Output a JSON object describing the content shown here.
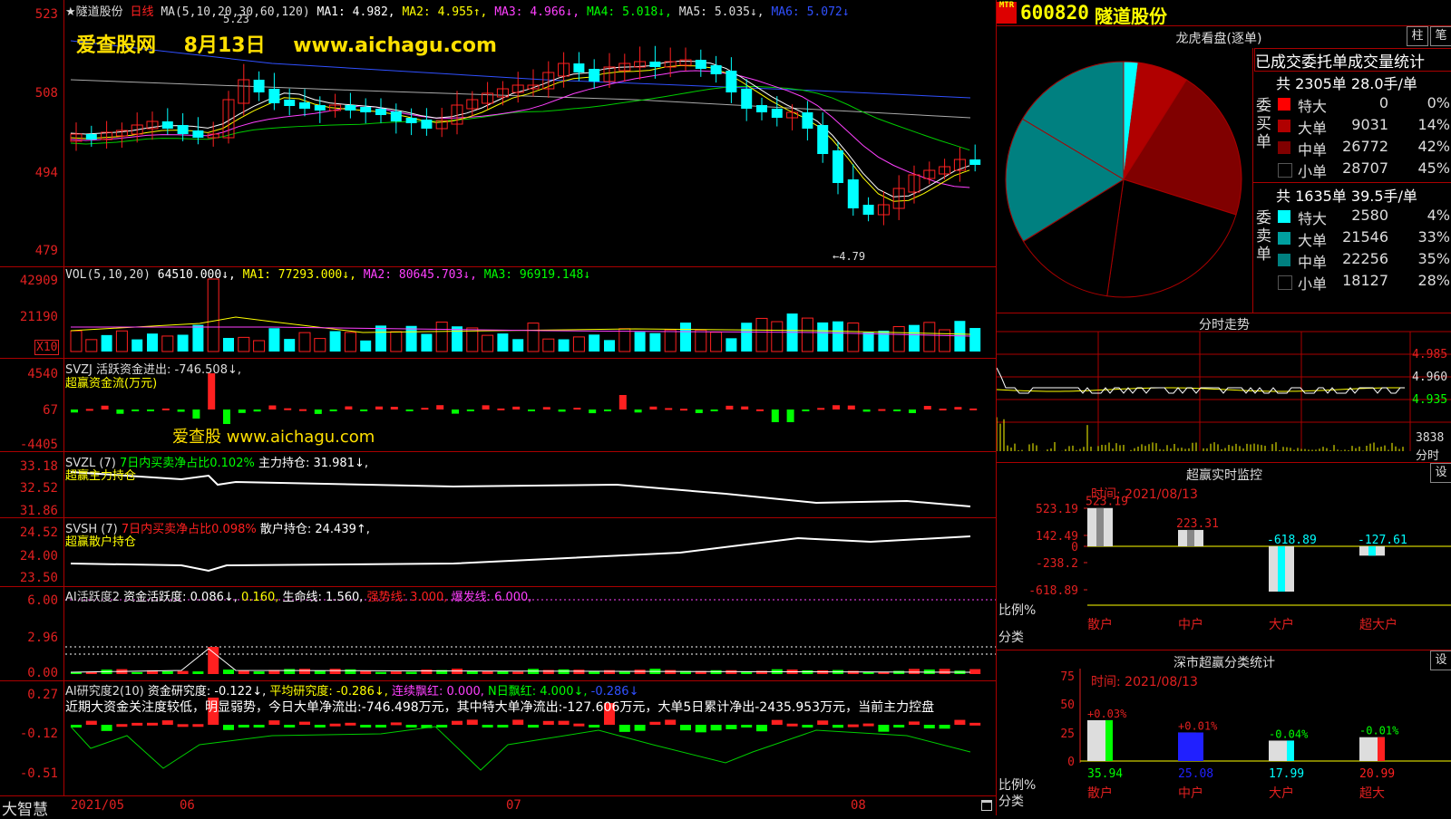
{
  "colors": {
    "up": "#ff2020",
    "down": "#00ffff",
    "bg": "#000000",
    "grid": "#aa0000",
    "yellow": "#ffff00",
    "magenta": "#ff40ff",
    "green": "#00ff00",
    "white": "#ffffff",
    "axis": "#e02020"
  },
  "watermark": {
    "site": "爱查股网",
    "date": "8月13日",
    "url": "www.aichagu.com",
    "small": "爱查股 www.aichagu.com"
  },
  "kline": {
    "title": "★隧道股份",
    "period": "日线",
    "ma_params": "MA(5,10,20,30,60,120)",
    "ma1": "MA1: 4.982,",
    "ma2": "MA2: 4.955↑,",
    "ma3": "MA3: 4.966↓,",
    "ma4": "MA4: 5.018↓,",
    "ma5": "MA5: 5.035↓,",
    "ma6": "MA6: 5.072↓",
    "y_labels": [
      "523",
      "508",
      "494",
      "479"
    ],
    "high_label": "5.23",
    "low_label": "←4.79"
  },
  "vol": {
    "header": "VOL(5,10,20)",
    "v": "64510.000↓,",
    "ma1": "MA1: 77293.000↓,",
    "ma2": "MA2: 80645.703↓,",
    "ma3": "MA3: 96919.148↓",
    "y_labels": [
      "42909",
      "21190"
    ],
    "unit": "X10"
  },
  "svzj": {
    "header": "SVZJ  活跃资金进出: -746.508↓,",
    "sub": "超赢资金流(万元)",
    "y_labels": [
      "4540",
      "67",
      "-4405"
    ]
  },
  "svzl": {
    "header": "SVZL (7)",
    "tag": "7日内买卖净占比0.102%",
    "val": "主力持仓: 31.981↓,",
    "sub": "超赢主力持仓",
    "y_labels": [
      "33.18",
      "32.52",
      "31.86"
    ]
  },
  "svsh": {
    "header": "SVSH (7)",
    "tag": "7日内买卖净占比0.098%",
    "val": "散户持仓: 24.439↑,",
    "sub": "超赢散户持仓",
    "y_labels": [
      "24.52",
      "24.00",
      "23.50"
    ]
  },
  "aihy": {
    "header": "AI活跃度2",
    "a": "资金活跃度: 0.086↓,",
    "b": "0.160,",
    "c": "生命线: 1.560,",
    "d": "强势线: 3.000,",
    "e": "爆发线: 6.000,",
    "y_labels": [
      "6.00",
      "2.96",
      "0.00"
    ]
  },
  "aiyj": {
    "header": "AI研究度2(10)",
    "a": "资金研究度: -0.122↓,",
    "b": "平均研究度: -0.286↓,",
    "c": "连续飘红: 0.000,",
    "d": "N日飘红: 4.000↓,",
    "e": "-0.286↓",
    "note": "近期大资金关注度较低，明显弱势，今日大单净流出:-746.498万元，其中特大单净流出:-127.606万元，大单5日累计净出-2435.953万元，当前主力控盘",
    "y_labels": [
      "0.27",
      "-0.12",
      "-0.51"
    ]
  },
  "bottom": {
    "brand": "大智慧",
    "dates": [
      "2021/05",
      "06",
      "07",
      "08"
    ]
  },
  "right": {
    "code": "600820",
    "name": "隧道股份",
    "logo": "MTR",
    "lhb_title": "龙虎看盘(逐单)",
    "btn_zhu": "柱",
    "btn_bi": "笔",
    "stats_title": "已成交委托单成交量统计",
    "buy": {
      "label": "委买单",
      "summary": "共 2305单 28.0手/单",
      "rows": [
        {
          "name": "特大",
          "val": "0",
          "pct": "0%",
          "color": "#ff0000"
        },
        {
          "name": "大单",
          "val": "9031",
          "pct": "14%",
          "color": "#b00000"
        },
        {
          "name": "中单",
          "val": "26772",
          "pct": "42%",
          "color": "#800000"
        },
        {
          "name": "小单",
          "val": "28707",
          "pct": "45%",
          "color": "#000000"
        }
      ]
    },
    "sell": {
      "label": "委卖单",
      "summary": "共 1635单 39.5手/单",
      "rows": [
        {
          "name": "特大",
          "val": "2580",
          "pct": "4%",
          "color": "#00ffff"
        },
        {
          "name": "大单",
          "val": "21546",
          "pct": "33%",
          "color": "#00a0a0"
        },
        {
          "name": "中单",
          "val": "22256",
          "pct": "35%",
          "color": "#008080"
        },
        {
          "name": "小单",
          "val": "18127",
          "pct": "28%",
          "color": "#000000"
        }
      ]
    },
    "pie": [
      {
        "label": "特大卖",
        "share": 4,
        "color": "#00ffff"
      },
      {
        "label": "特大买",
        "share": 0,
        "color": "#ff0000"
      },
      {
        "label": "大买",
        "share": 14,
        "color": "#b00000"
      },
      {
        "label": "中买",
        "share": 42,
        "color": "#800000"
      },
      {
        "label": "小买",
        "share": 45,
        "color": "#000000"
      },
      {
        "label": "小卖",
        "share": 28,
        "color": "#000000"
      },
      {
        "label": "中卖",
        "share": 35,
        "color": "#008080"
      },
      {
        "label": "大卖",
        "share": 33,
        "color": "#008080"
      }
    ],
    "fs_title": "分时走势",
    "fs_y": [
      "4.985",
      "4.960",
      "4.935"
    ],
    "fs_vol": "3838",
    "fs_unit": "分时",
    "mon_title": "超赢实时监控",
    "mon_set": "设",
    "mon_time": "时间: 2021/08/13",
    "mon_y": [
      "523.19",
      "142.49",
      "0",
      "-238.2",
      "-618.89"
    ],
    "mon_ratio": "比例%",
    "mon_cat_label": "分类",
    "mon_bars": [
      {
        "cat": "散户",
        "val": 523.19,
        "label": "523.19"
      },
      {
        "cat": "中户",
        "val": 223.31,
        "label": "223.31"
      },
      {
        "cat": "大户",
        "val": -618.89,
        "label": "-618.89"
      },
      {
        "cat": "超大户",
        "val": -127.61,
        "label": "-127.61"
      }
    ],
    "cls_title": "深市超赢分类统计",
    "cls_set": "设",
    "cls_time": "时间: 2021/08/13",
    "cls_y": [
      "75",
      "50",
      "25",
      "0"
    ],
    "cls_ratio": "比例%",
    "cls_cat_label": "分类",
    "cls_bars": [
      {
        "cat": "散户",
        "val": 35.94,
        "delta": "+0.03%",
        "color": "#00ff00"
      },
      {
        "cat": "中户",
        "val": 25.08,
        "delta": "+0.01%",
        "color": "#2020ff"
      },
      {
        "cat": "大户",
        "val": 17.99,
        "delta": "-0.04%",
        "color": "#00ffff"
      },
      {
        "cat": "超大",
        "val": 20.99,
        "delta": "-0.01%",
        "color": "#ff2020"
      }
    ]
  }
}
